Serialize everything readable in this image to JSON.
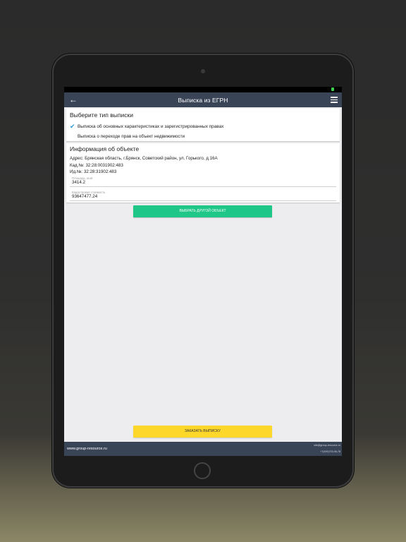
{
  "app": {
    "title": "Выписка из ЕГРН"
  },
  "extract_type": {
    "heading": "Выберите тип выписки",
    "options": [
      {
        "label": "Выписка об основных характеристиках и зарегистрированных правах",
        "selected": true
      },
      {
        "label": "Выписка о переходе прав на объект недвижимости",
        "selected": false
      }
    ]
  },
  "object_info": {
    "heading": "Информация об объекте",
    "address": "Адрес: Брянская область, г.Брянск, Советский район, ул. Горького, д.16А",
    "cadastral": "Кад.№: 32:28:0031902:483",
    "id_number": "Ид.№: 32:28:31902:483",
    "area_label": "Площадь, м.кв",
    "area_value": "3414.2",
    "cost_label": "Кадастровая стоимость",
    "cost_value": "93647477.24"
  },
  "buttons": {
    "choose_other": "ВЫБРАТЬ ДРУГОЙ ОБЪЕКТ",
    "order": "ЗАКАЗАТЬ ВЫПИСКУ"
  },
  "footer": {
    "url": "www.group-resource.ru",
    "email": "site@group-resource.ru",
    "phone": "+7(499)703-06-78"
  },
  "colors": {
    "appbar": "#3a4457",
    "accent_check": "#2a9bd8",
    "button_green": "#1ec688",
    "button_yellow": "#fdd72a"
  }
}
